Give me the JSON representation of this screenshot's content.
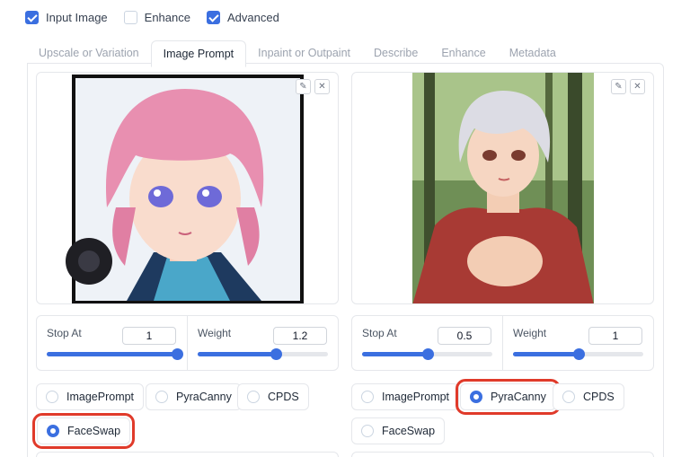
{
  "top_options": [
    {
      "label": "Input Image",
      "checked": true
    },
    {
      "label": "Enhance",
      "checked": false
    },
    {
      "label": "Advanced",
      "checked": true
    }
  ],
  "tabs": [
    {
      "label": "Upscale or Variation",
      "active": false
    },
    {
      "label": "Image Prompt",
      "active": true
    },
    {
      "label": "Inpaint or Outpaint",
      "active": false
    },
    {
      "label": "Describe",
      "active": false
    },
    {
      "label": "Enhance",
      "active": false
    },
    {
      "label": "Metadata",
      "active": false
    }
  ],
  "icons": {
    "edit": "pencil-icon",
    "clear": "close-icon"
  },
  "colors": {
    "accent": "#3b6fe0",
    "highlight": "#e03a2a"
  },
  "slots": [
    {
      "stop_at": {
        "label": "Stop At",
        "value": "1",
        "fraction": 1.0
      },
      "weight": {
        "label": "Weight",
        "value": "1.2",
        "fraction": 0.6
      },
      "options": [
        "ImagePrompt",
        "PyraCanny",
        "CPDS",
        "FaceSwap"
      ],
      "selected": "FaceSwap"
    },
    {
      "stop_at": {
        "label": "Stop At",
        "value": "0.5",
        "fraction": 0.5
      },
      "weight": {
        "label": "Weight",
        "value": "1",
        "fraction": 0.5
      },
      "options": [
        "ImagePrompt",
        "PyraCanny",
        "CPDS",
        "FaceSwap"
      ],
      "selected": "PyraCanny"
    }
  ]
}
